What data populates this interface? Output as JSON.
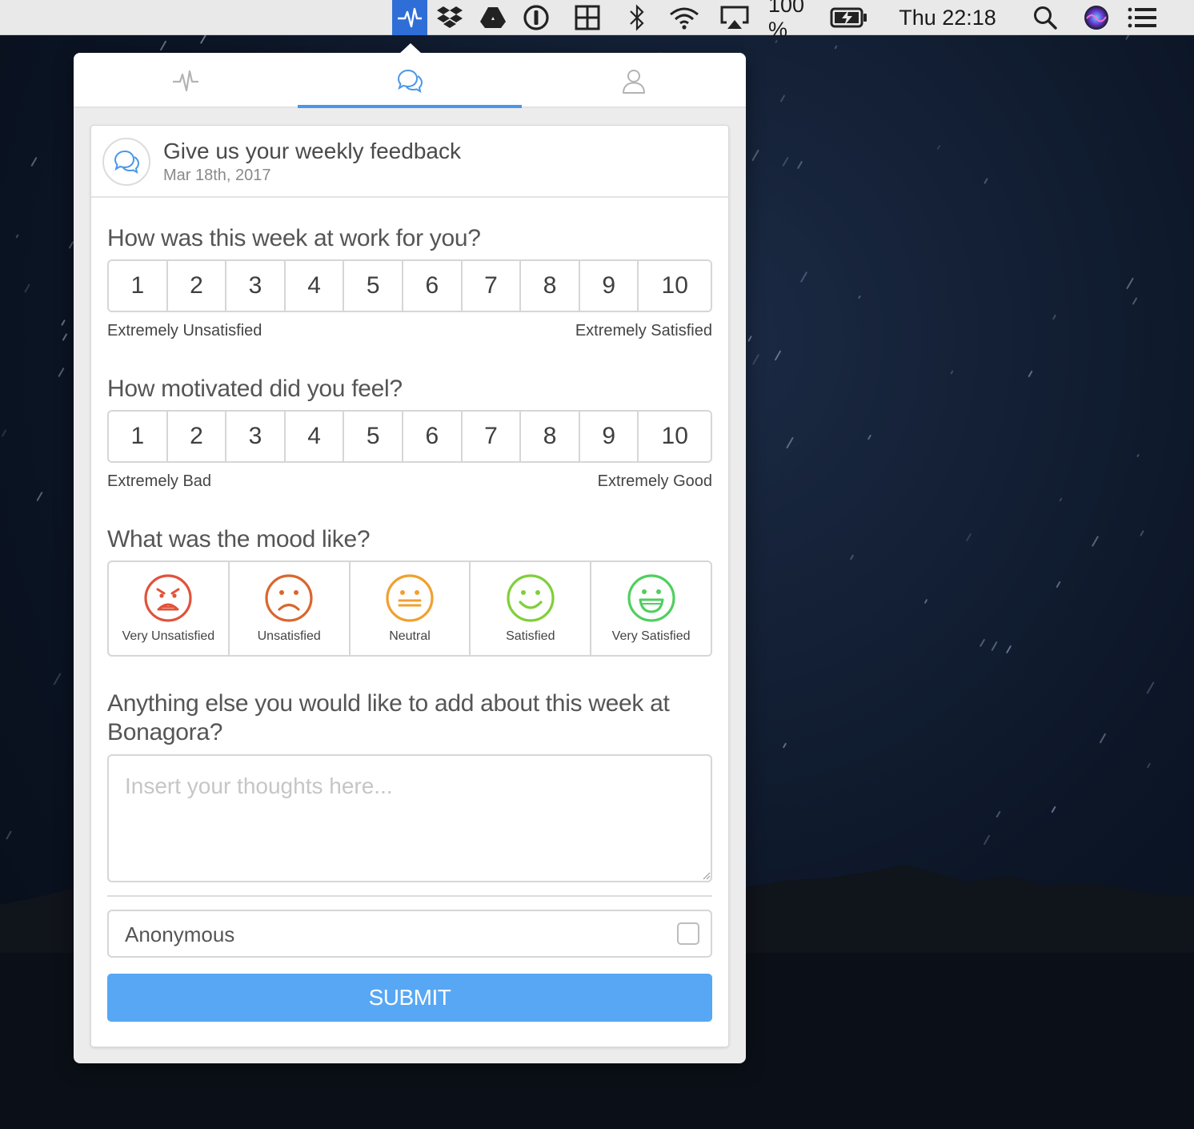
{
  "menubar": {
    "battery_percent": "100 %",
    "clock": "Thu 22:18",
    "icons": [
      "pulse-icon",
      "dropbox-icon",
      "google-drive-icon",
      "1password-icon",
      "window-grid-icon",
      "bluetooth-icon",
      "wifi-icon",
      "airplay-icon",
      "battery-charging-icon",
      "search-icon",
      "siri-icon",
      "menu-list-icon"
    ],
    "active_color": "#2f6ed6"
  },
  "tabs": [
    {
      "icon": "pulse-icon",
      "active": false
    },
    {
      "icon": "chat-bubbles-icon",
      "active": true
    },
    {
      "icon": "user-icon",
      "active": false
    }
  ],
  "card": {
    "title": "Give us your weekly feedback",
    "date": "Mar 18th, 2017"
  },
  "questions": {
    "q1": {
      "text": "How was this week at work for you?",
      "options": [
        "1",
        "2",
        "3",
        "4",
        "5",
        "6",
        "7",
        "8",
        "9",
        "10"
      ],
      "min_label": "Extremely Unsatisfied",
      "max_label": "Extremely Satisfied"
    },
    "q2": {
      "text": "How motivated did you feel?",
      "options": [
        "1",
        "2",
        "3",
        "4",
        "5",
        "6",
        "7",
        "8",
        "9",
        "10"
      ],
      "min_label": "Extremely Bad",
      "max_label": "Extremely Good"
    },
    "q3": {
      "text": "What was the mood like?",
      "moods": [
        {
          "label": "Very Unsatisfied",
          "color": "#e0533a"
        },
        {
          "label": "Unsatisfied",
          "color": "#d9662e"
        },
        {
          "label": "Neutral",
          "color": "#f0a030"
        },
        {
          "label": "Satisfied",
          "color": "#7fcf3a"
        },
        {
          "label": "Very Satisfied",
          "color": "#4fcf5f"
        }
      ]
    },
    "q4": {
      "text": "Anything else you would like to add about this week at Bonagora?",
      "placeholder": "Insert your thoughts here..."
    }
  },
  "anonymous": {
    "label": "Anonymous",
    "checked": false
  },
  "submit": {
    "label": "SUBMIT",
    "color": "#57a7f4"
  },
  "accent": "#4a97e8"
}
